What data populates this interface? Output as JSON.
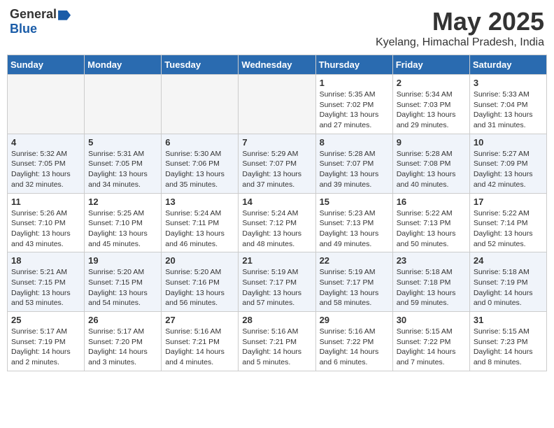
{
  "header": {
    "logo_general": "General",
    "logo_blue": "Blue",
    "month_year": "May 2025",
    "location": "Kyelang, Himachal Pradesh, India"
  },
  "weekdays": [
    "Sunday",
    "Monday",
    "Tuesday",
    "Wednesday",
    "Thursday",
    "Friday",
    "Saturday"
  ],
  "weeks": [
    [
      {
        "day": "",
        "detail": ""
      },
      {
        "day": "",
        "detail": ""
      },
      {
        "day": "",
        "detail": ""
      },
      {
        "day": "",
        "detail": ""
      },
      {
        "day": "1",
        "detail": "Sunrise: 5:35 AM\nSunset: 7:02 PM\nDaylight: 13 hours\nand 27 minutes."
      },
      {
        "day": "2",
        "detail": "Sunrise: 5:34 AM\nSunset: 7:03 PM\nDaylight: 13 hours\nand 29 minutes."
      },
      {
        "day": "3",
        "detail": "Sunrise: 5:33 AM\nSunset: 7:04 PM\nDaylight: 13 hours\nand 31 minutes."
      }
    ],
    [
      {
        "day": "4",
        "detail": "Sunrise: 5:32 AM\nSunset: 7:05 PM\nDaylight: 13 hours\nand 32 minutes."
      },
      {
        "day": "5",
        "detail": "Sunrise: 5:31 AM\nSunset: 7:05 PM\nDaylight: 13 hours\nand 34 minutes."
      },
      {
        "day": "6",
        "detail": "Sunrise: 5:30 AM\nSunset: 7:06 PM\nDaylight: 13 hours\nand 35 minutes."
      },
      {
        "day": "7",
        "detail": "Sunrise: 5:29 AM\nSunset: 7:07 PM\nDaylight: 13 hours\nand 37 minutes."
      },
      {
        "day": "8",
        "detail": "Sunrise: 5:28 AM\nSunset: 7:07 PM\nDaylight: 13 hours\nand 39 minutes."
      },
      {
        "day": "9",
        "detail": "Sunrise: 5:28 AM\nSunset: 7:08 PM\nDaylight: 13 hours\nand 40 minutes."
      },
      {
        "day": "10",
        "detail": "Sunrise: 5:27 AM\nSunset: 7:09 PM\nDaylight: 13 hours\nand 42 minutes."
      }
    ],
    [
      {
        "day": "11",
        "detail": "Sunrise: 5:26 AM\nSunset: 7:10 PM\nDaylight: 13 hours\nand 43 minutes."
      },
      {
        "day": "12",
        "detail": "Sunrise: 5:25 AM\nSunset: 7:10 PM\nDaylight: 13 hours\nand 45 minutes."
      },
      {
        "day": "13",
        "detail": "Sunrise: 5:24 AM\nSunset: 7:11 PM\nDaylight: 13 hours\nand 46 minutes."
      },
      {
        "day": "14",
        "detail": "Sunrise: 5:24 AM\nSunset: 7:12 PM\nDaylight: 13 hours\nand 48 minutes."
      },
      {
        "day": "15",
        "detail": "Sunrise: 5:23 AM\nSunset: 7:13 PM\nDaylight: 13 hours\nand 49 minutes."
      },
      {
        "day": "16",
        "detail": "Sunrise: 5:22 AM\nSunset: 7:13 PM\nDaylight: 13 hours\nand 50 minutes."
      },
      {
        "day": "17",
        "detail": "Sunrise: 5:22 AM\nSunset: 7:14 PM\nDaylight: 13 hours\nand 52 minutes."
      }
    ],
    [
      {
        "day": "18",
        "detail": "Sunrise: 5:21 AM\nSunset: 7:15 PM\nDaylight: 13 hours\nand 53 minutes."
      },
      {
        "day": "19",
        "detail": "Sunrise: 5:20 AM\nSunset: 7:15 PM\nDaylight: 13 hours\nand 54 minutes."
      },
      {
        "day": "20",
        "detail": "Sunrise: 5:20 AM\nSunset: 7:16 PM\nDaylight: 13 hours\nand 56 minutes."
      },
      {
        "day": "21",
        "detail": "Sunrise: 5:19 AM\nSunset: 7:17 PM\nDaylight: 13 hours\nand 57 minutes."
      },
      {
        "day": "22",
        "detail": "Sunrise: 5:19 AM\nSunset: 7:17 PM\nDaylight: 13 hours\nand 58 minutes."
      },
      {
        "day": "23",
        "detail": "Sunrise: 5:18 AM\nSunset: 7:18 PM\nDaylight: 13 hours\nand 59 minutes."
      },
      {
        "day": "24",
        "detail": "Sunrise: 5:18 AM\nSunset: 7:19 PM\nDaylight: 14 hours\nand 0 minutes."
      }
    ],
    [
      {
        "day": "25",
        "detail": "Sunrise: 5:17 AM\nSunset: 7:19 PM\nDaylight: 14 hours\nand 2 minutes."
      },
      {
        "day": "26",
        "detail": "Sunrise: 5:17 AM\nSunset: 7:20 PM\nDaylight: 14 hours\nand 3 minutes."
      },
      {
        "day": "27",
        "detail": "Sunrise: 5:16 AM\nSunset: 7:21 PM\nDaylight: 14 hours\nand 4 minutes."
      },
      {
        "day": "28",
        "detail": "Sunrise: 5:16 AM\nSunset: 7:21 PM\nDaylight: 14 hours\nand 5 minutes."
      },
      {
        "day": "29",
        "detail": "Sunrise: 5:16 AM\nSunset: 7:22 PM\nDaylight: 14 hours\nand 6 minutes."
      },
      {
        "day": "30",
        "detail": "Sunrise: 5:15 AM\nSunset: 7:22 PM\nDaylight: 14 hours\nand 7 minutes."
      },
      {
        "day": "31",
        "detail": "Sunrise: 5:15 AM\nSunset: 7:23 PM\nDaylight: 14 hours\nand 8 minutes."
      }
    ]
  ]
}
